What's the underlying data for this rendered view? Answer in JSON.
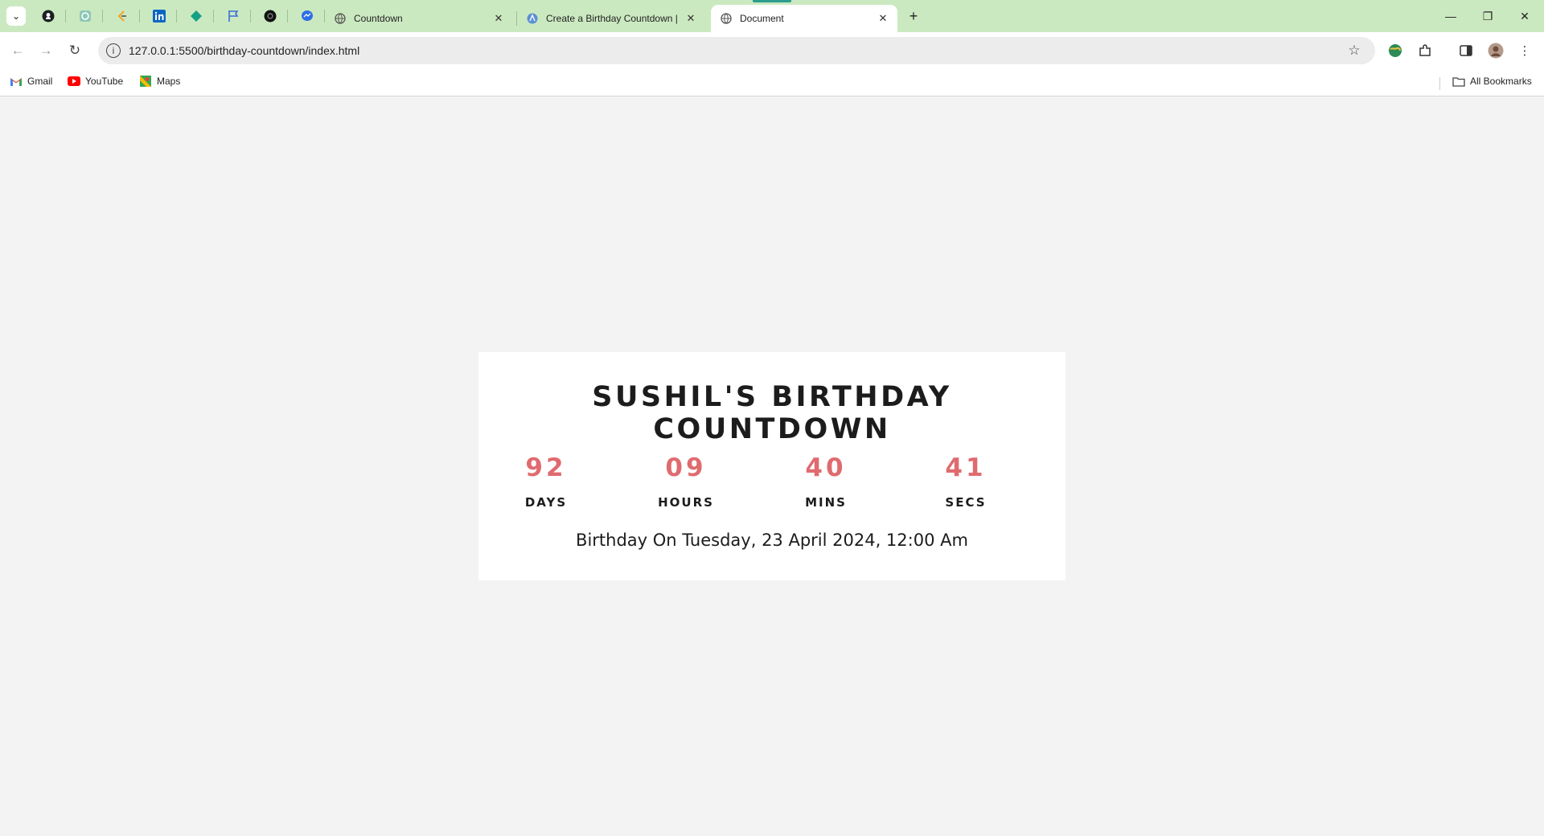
{
  "browser": {
    "tabs": [
      {
        "title": "Countdown",
        "close": "✕"
      },
      {
        "title": "Create a Birthday Countdown |",
        "close": "✕"
      },
      {
        "title": "Document",
        "close": "✕"
      }
    ],
    "new_tab": "+",
    "window": {
      "minimize": "—",
      "restore": "❐",
      "close": "✕"
    },
    "url": "127.0.0.1:5500/birthday-countdown/index.html",
    "bookmarks": [
      {
        "label": "Gmail",
        "icon": "gmail-icon"
      },
      {
        "label": "YouTube",
        "icon": "youtube-icon"
      },
      {
        "label": "Maps",
        "icon": "maps-icon"
      }
    ],
    "all_bookmarks": "All Bookmarks"
  },
  "page": {
    "title": "SUSHIL'S BIRTHDAY COUNTDOWN",
    "countdown": [
      {
        "value": "92",
        "label": "DAYS"
      },
      {
        "value": "09",
        "label": "HOURS"
      },
      {
        "value": "40",
        "label": "MINS"
      },
      {
        "value": "41",
        "label": "SECS"
      }
    ],
    "birthday_text": "Birthday On Tuesday, 23 April 2024, 12:00 Am"
  },
  "colors": {
    "tabstrip": "#cbe9c0",
    "page_background": "#f3f3f3",
    "countdown_number": "#df6b6f",
    "text_dark": "#1c1c1c"
  }
}
